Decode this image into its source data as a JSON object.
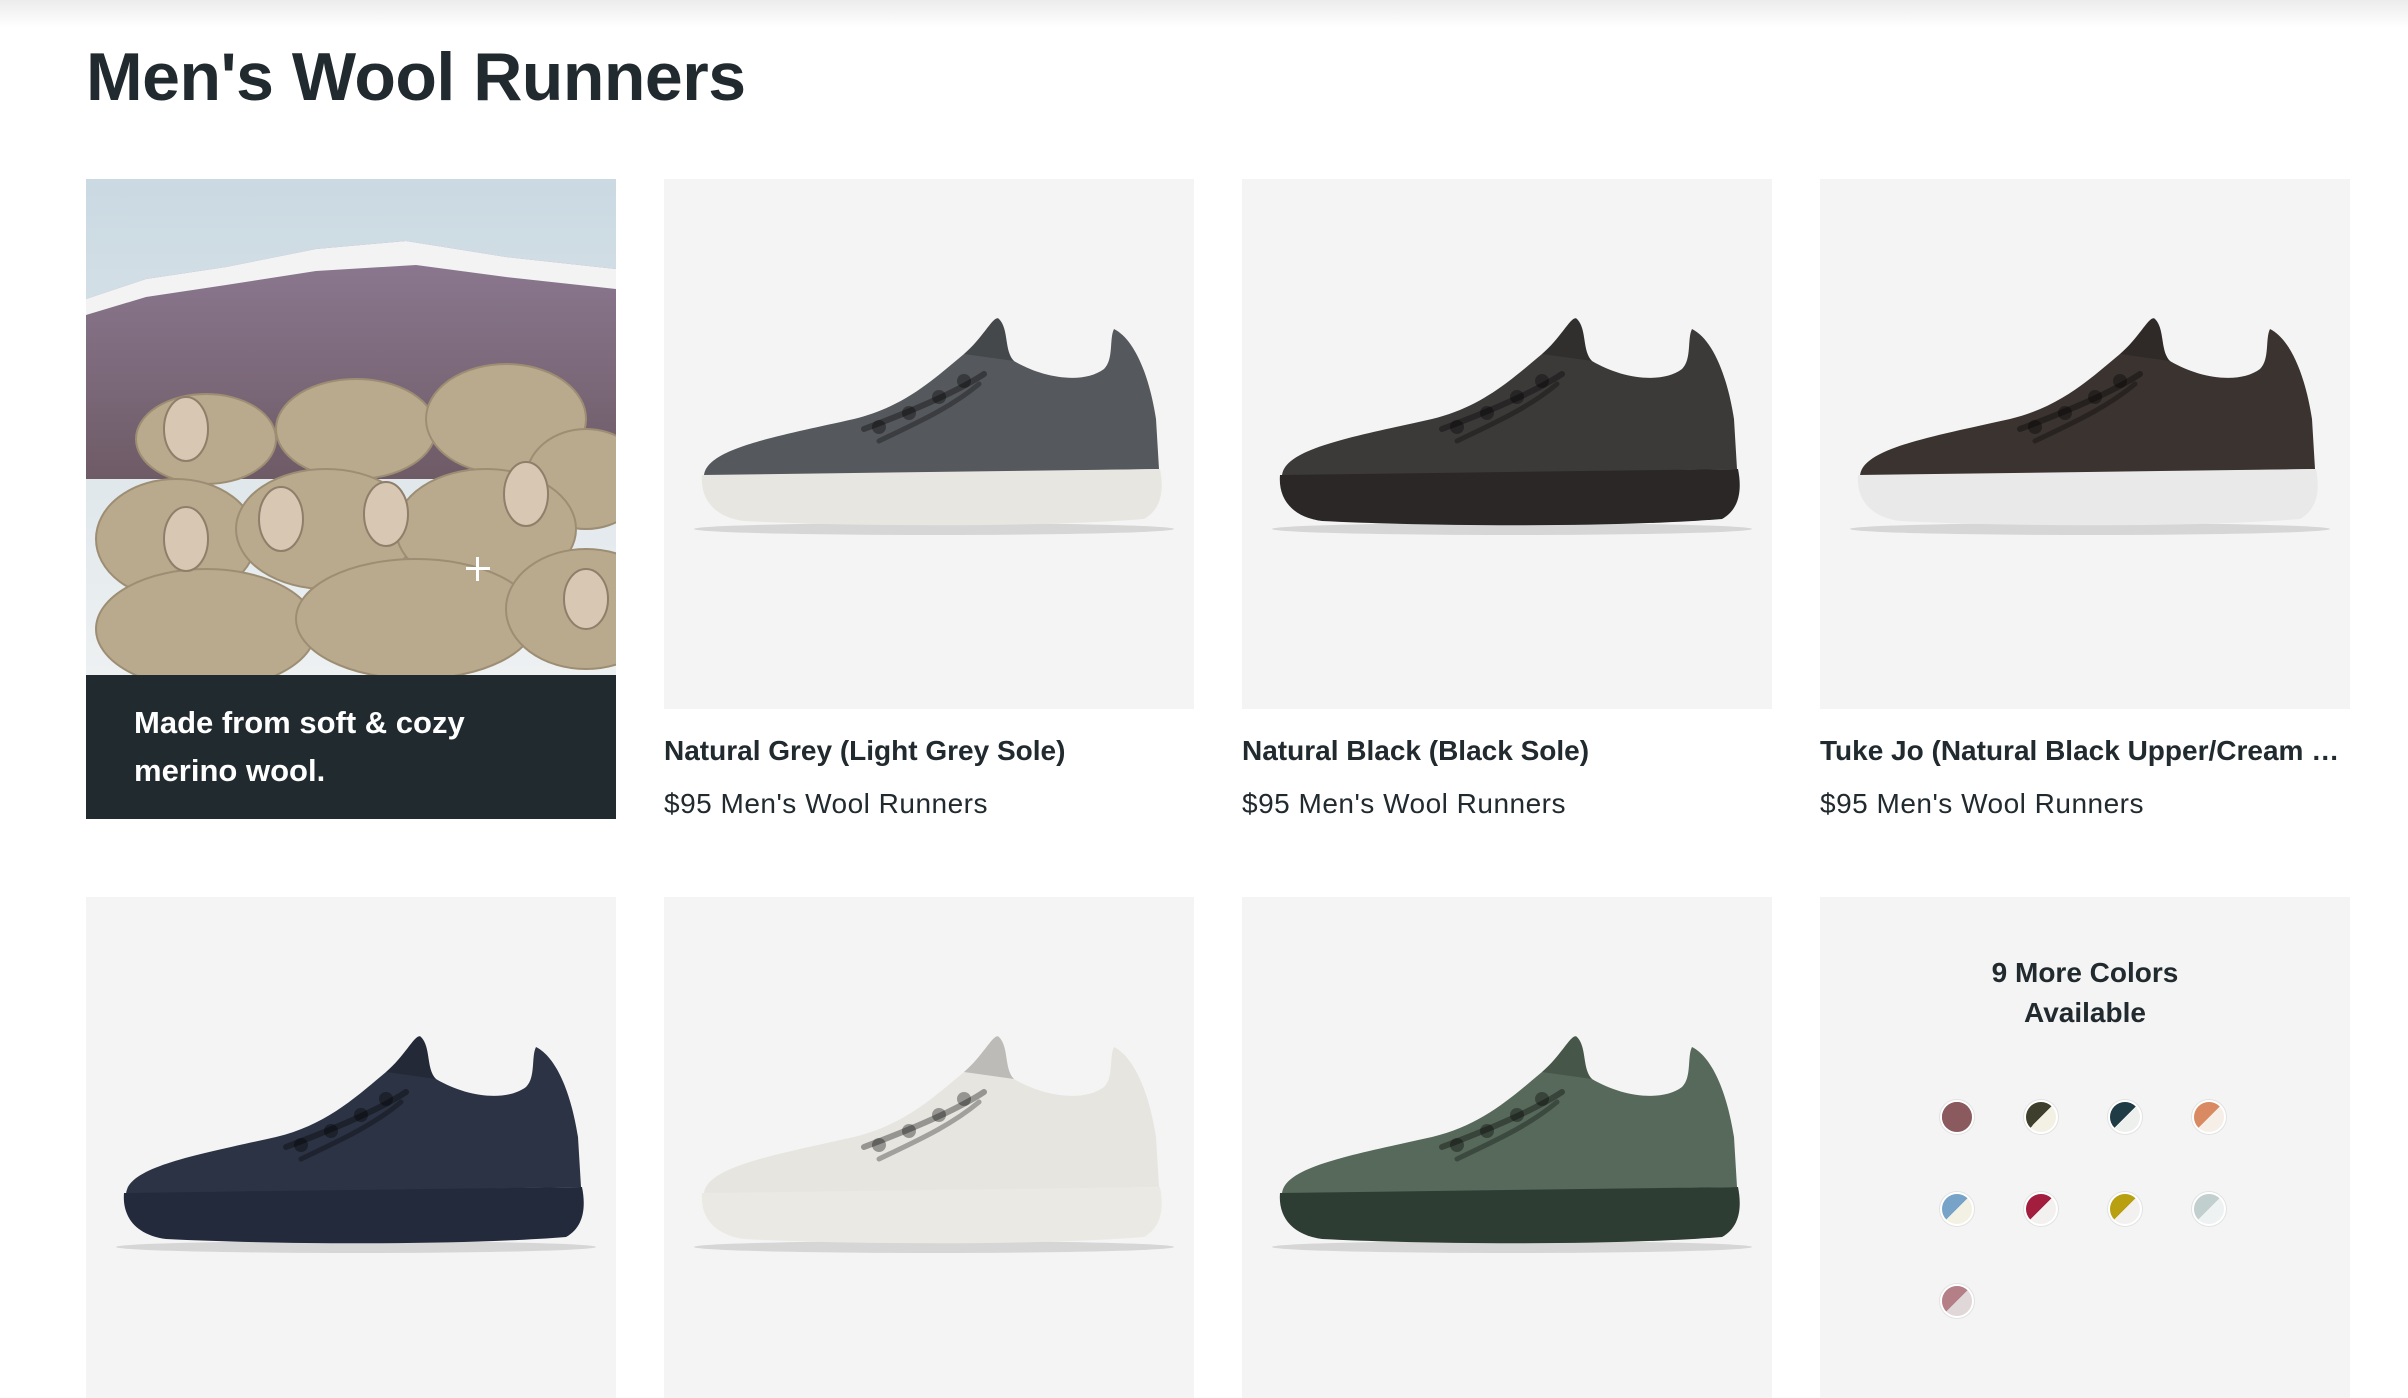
{
  "page": {
    "title": "Men's Wool Runners"
  },
  "promo": {
    "text": "Made from soft & cozy merino wool.",
    "plus_icon": "+"
  },
  "products": [
    {
      "name": "Natural Grey (Light Grey Sole)",
      "price_line": "$95 Men's Wool Runners",
      "upper": "#55585c",
      "sole": "#e8e6e1"
    },
    {
      "name": "Natural Black (Black Sole)",
      "price_line": "$95 Men's Wool Runners",
      "upper": "#3c3a39",
      "sole": "#2a2726"
    },
    {
      "name": "Tuke Jo (Natural Black Upper/Cream Sole)",
      "price_line": "$95 Men's Wool Runners",
      "upper": "#3a3330",
      "sole": "#e9e9ea"
    },
    {
      "upper": "#2b3344",
      "sole": "#222a3c"
    },
    {
      "upper": "#e7e5e0",
      "sole": "#ebe9e4"
    },
    {
      "upper": "#56695a",
      "sole": "#2e3d33"
    }
  ],
  "more_colors": {
    "title_line1": "9 More Colors",
    "title_line2": "Available",
    "swatches": [
      {
        "upper": "#8a5a5e",
        "sole": "#8a5a5e"
      },
      {
        "upper": "#3f3f2d",
        "sole": "#f3f1e4"
      },
      {
        "upper": "#1f3b45",
        "sole": "#eef0ee"
      },
      {
        "upper": "#d98a63",
        "sole": "#f5efe7"
      },
      {
        "upper": "#78a3c8",
        "sole": "#f3f1e4"
      },
      {
        "upper": "#a31d3e",
        "sole": "#f3f1ef"
      },
      {
        "upper": "#b8a010",
        "sole": "#f3f1ef"
      },
      {
        "upper": "#c2cfcf",
        "sole": "#eef2f2"
      },
      {
        "upper": "#b47f86",
        "sole": "#e0d7d8"
      }
    ]
  }
}
